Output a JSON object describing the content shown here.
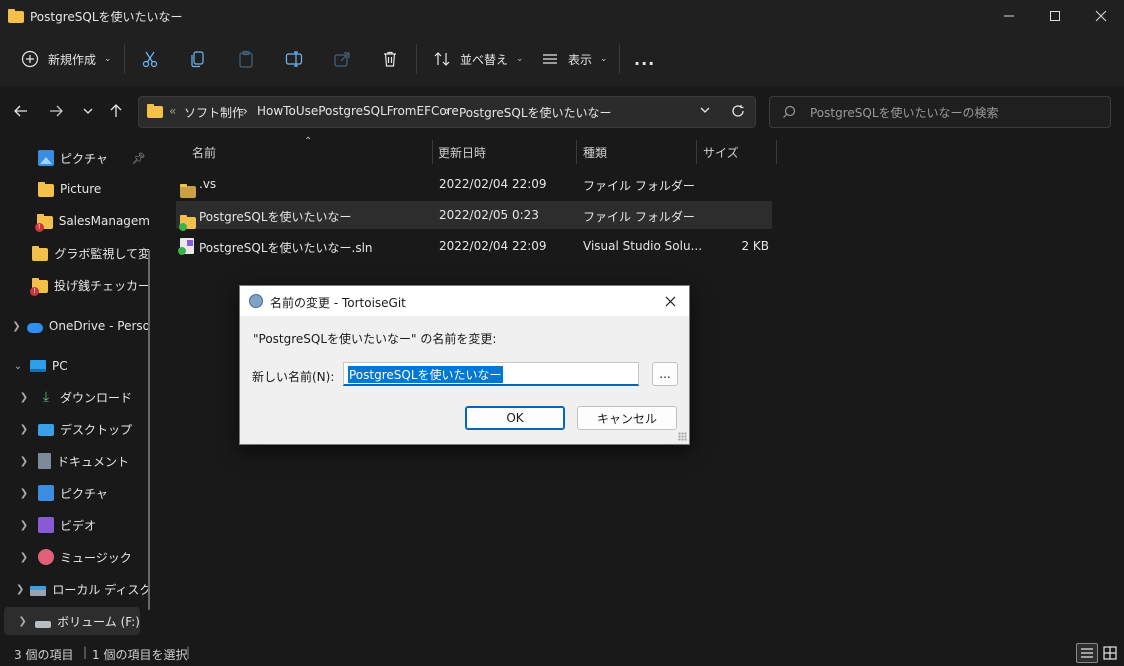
{
  "window": {
    "title": "PostgreSQLを使いたいなー"
  },
  "toolbar": {
    "new_label": "新規作成",
    "sort_label": "並べ替え",
    "view_label": "表示",
    "more_label": "..."
  },
  "address": {
    "overflow": "«",
    "crumbs": [
      "ソフト制作",
      "HowToUsePostgreSQLFromEFCore",
      "PostgreSQLを使いたいなー"
    ],
    "search_placeholder": "PostgreSQLを使いたいなーの検索"
  },
  "sidebar": {
    "items": [
      {
        "label": "ピクチャ",
        "icon": "pictures-icon"
      },
      {
        "label": "Picture",
        "icon": "folder-icon"
      },
      {
        "label": "SalesManagem",
        "icon": "folder-warning-icon"
      },
      {
        "label": "グラボ監視して変",
        "icon": "folder-icon"
      },
      {
        "label": "投げ銭チェッカー",
        "icon": "folder-warning-icon"
      },
      {
        "label": "OneDrive - Perso",
        "icon": "onedrive-icon"
      },
      {
        "label": "PC",
        "icon": "pc-icon"
      },
      {
        "label": "ダウンロード",
        "icon": "downloads-icon"
      },
      {
        "label": "デスクトップ",
        "icon": "desktop-icon"
      },
      {
        "label": "ドキュメント",
        "icon": "documents-icon"
      },
      {
        "label": "ピクチャ",
        "icon": "pictures-icon"
      },
      {
        "label": "ビデオ",
        "icon": "videos-icon"
      },
      {
        "label": "ミュージック",
        "icon": "music-icon"
      },
      {
        "label": "ローカル ディスク (",
        "icon": "disk-icon"
      },
      {
        "label": "ボリューム (F:)",
        "icon": "drive-icon"
      }
    ]
  },
  "filelist": {
    "columns": {
      "name": "名前",
      "date": "更新日時",
      "type": "種類",
      "size": "サイズ"
    },
    "rows": [
      {
        "name": ".vs",
        "date": "2022/02/04 22:09",
        "type": "ファイル フォルダー",
        "size": ""
      },
      {
        "name": "PostgreSQLを使いたいなー",
        "date": "2022/02/05 0:23",
        "type": "ファイル フォルダー",
        "size": ""
      },
      {
        "name": "PostgreSQLを使いたいなー.sln",
        "date": "2022/02/04 22:09",
        "type": "Visual Studio Solu...",
        "size": "2 KB"
      }
    ]
  },
  "status": {
    "count": "3 個の項目",
    "selected": "1 個の項目を選択"
  },
  "dialog": {
    "title": "名前の変更 - TortoiseGit",
    "prompt": "\"PostgreSQLを使いたいなー\" の名前を変更:",
    "field_label": "新しい名前(N):",
    "field_value": "PostgreSQLを使いたいなー",
    "browse_label": "...",
    "ok_label": "OK",
    "cancel_label": "キャンセル"
  },
  "colors": {
    "accent": "#0067c0",
    "folder": "#f2c04b",
    "background": "#191919"
  }
}
